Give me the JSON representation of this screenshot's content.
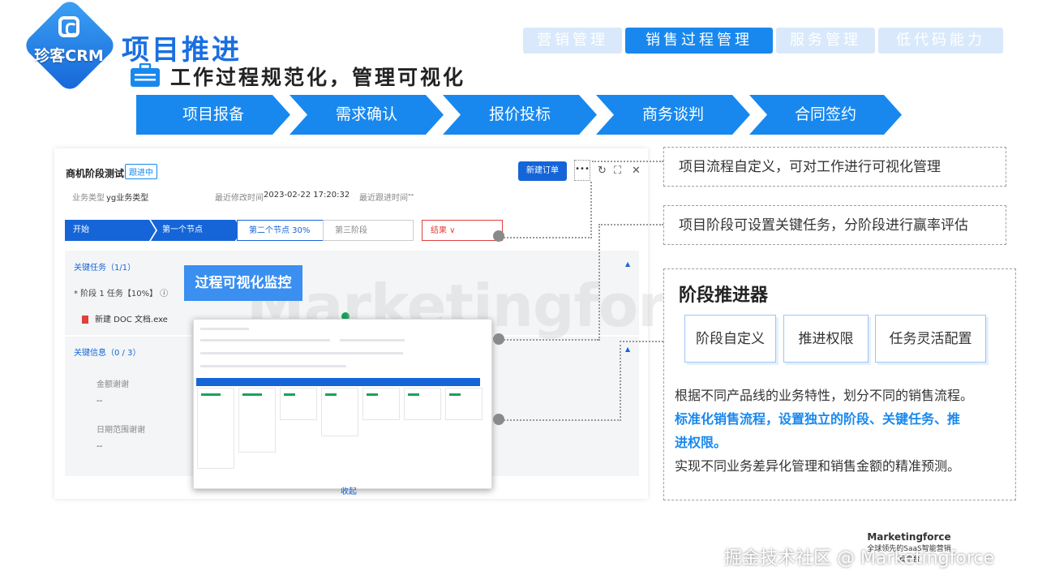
{
  "logo": {
    "text": "珍客CRM"
  },
  "page_title": "项目推进",
  "subtitle": "工作过程规范化，管理可视化",
  "tabs": [
    {
      "label": "营销管理"
    },
    {
      "label": "销售过程管理"
    },
    {
      "label": "服务管理"
    },
    {
      "label": "低代码能力"
    }
  ],
  "process_steps": [
    "项目报备",
    "需求确认",
    "报价投标",
    "商务谈判",
    "合同签约"
  ],
  "screenshot": {
    "title": "商机阶段测试",
    "status_badge": "跟进中",
    "biz_type_label": "业务类型",
    "biz_type_value": "yg业务类型",
    "modified_label": "最近修改时间",
    "modified_value": "2023-02-22 17:20:32",
    "followup_label": "最近跟进时间",
    "followup_value": "--",
    "new_order_button": "新建订单",
    "more_icon": "•••",
    "steps": [
      "开始",
      "第一个节点",
      "第二个节点 30%",
      "第三阶段",
      "结果 ∨"
    ],
    "key_tasks_label": "关键任务（1/1）",
    "task_item": "* 阶段 1 任务【10%】 ⓘ",
    "file_name": "新建 DOC 文档.exe",
    "key_info_label": "关键信息（0 / 3）",
    "field1_label": "金额谢谢",
    "field1_value": "--",
    "field2_label": "日期范围谢谢",
    "field2_value": "--",
    "watermark": "Marketingforce",
    "overlay_label": "过程可视化监控",
    "bottom_link": "收起"
  },
  "callouts": {
    "box1": "项目流程自定义，可对工作进行可视化管理",
    "box2": "项目阶段可设置关键任务，分阶段进行赢率评估"
  },
  "advancer": {
    "title": "阶段推进器",
    "features": [
      "阶段自定义",
      "推进权限",
      "任务灵活配置"
    ],
    "desc1": "根据不同产品线的业务特性，划分不同的销售流程。",
    "desc_highlight_1": "标准化销售流程，设置独立的阶段、关键任务、推",
    "desc_highlight_2": "进权限。",
    "desc3": "实现不同业务差异化管理和销售金额的精准预测。"
  },
  "footer": {
    "text": "掘金技术社区 @ Marketingforce",
    "brand": "Marketingforce",
    "brand_sub": "全球领先的SaaS智能营销云平台"
  },
  "colors": {
    "primary": "#1888ee",
    "dark_blue": "#1565d8",
    "tab_inactive": "#d9e9fb",
    "text": "#333333"
  }
}
